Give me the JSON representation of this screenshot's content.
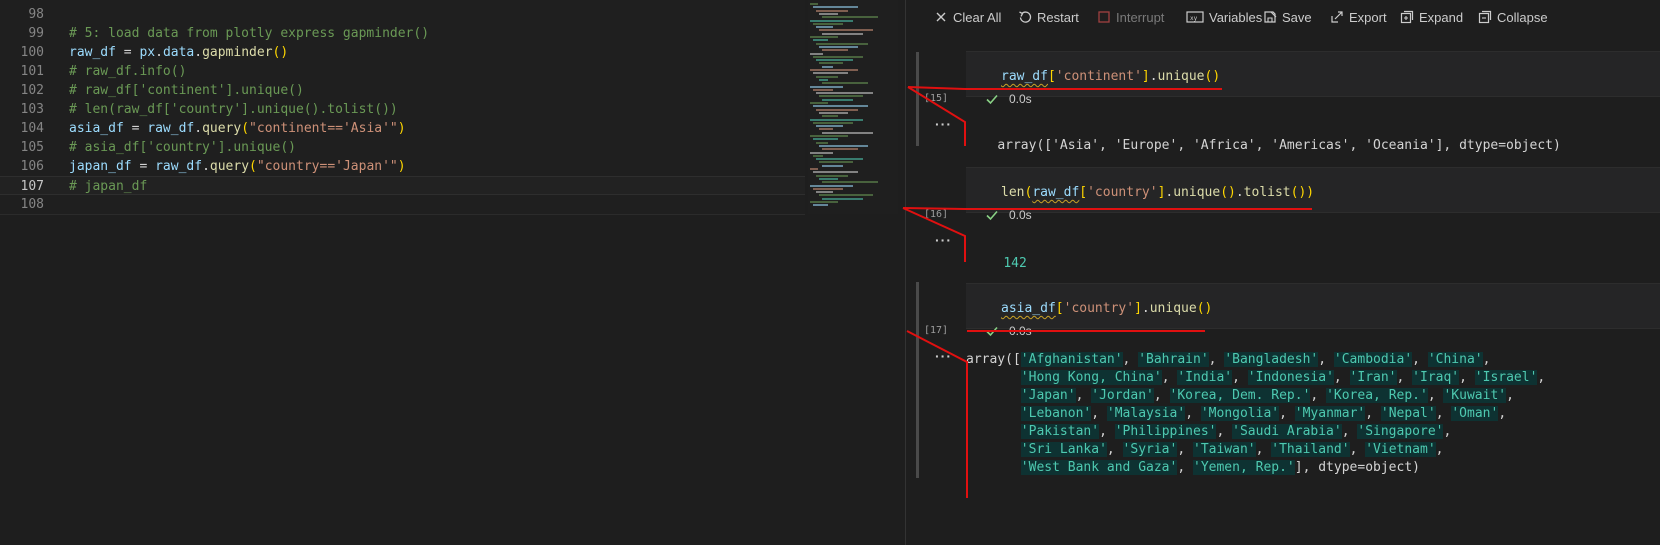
{
  "editor": {
    "lines": [
      {
        "num": "98",
        "tokens": []
      },
      {
        "num": "99",
        "tokens": [
          {
            "c": "cm",
            "t": "# 5: load data from plotly express gapminder()"
          }
        ]
      },
      {
        "num": "100",
        "tokens": [
          {
            "c": "id",
            "t": "raw_df"
          },
          {
            "c": "op",
            "t": " = "
          },
          {
            "c": "id",
            "t": "px"
          },
          {
            "c": "op",
            "t": "."
          },
          {
            "c": "id",
            "t": "data"
          },
          {
            "c": "op",
            "t": "."
          },
          {
            "c": "fn",
            "t": "gapminder"
          },
          {
            "c": "yb",
            "t": "()"
          }
        ]
      },
      {
        "num": "101",
        "tokens": [
          {
            "c": "cm",
            "t": "# raw_df.info()"
          }
        ]
      },
      {
        "num": "102",
        "tokens": [
          {
            "c": "cm",
            "t": "# raw_df['continent'].unique()"
          }
        ]
      },
      {
        "num": "103",
        "tokens": [
          {
            "c": "cm",
            "t": "# len(raw_df['country'].unique().tolist())"
          }
        ]
      },
      {
        "num": "104",
        "tokens": [
          {
            "c": "id",
            "t": "asia_df"
          },
          {
            "c": "op",
            "t": " = "
          },
          {
            "c": "id",
            "t": "raw_df"
          },
          {
            "c": "op",
            "t": "."
          },
          {
            "c": "fn",
            "t": "query"
          },
          {
            "c": "yb",
            "t": "("
          },
          {
            "c": "st",
            "t": "\"continent=='Asia'\""
          },
          {
            "c": "yb",
            "t": ")"
          }
        ]
      },
      {
        "num": "105",
        "tokens": [
          {
            "c": "cm",
            "t": "# asia_df['country'].unique()"
          }
        ]
      },
      {
        "num": "106",
        "tokens": [
          {
            "c": "id",
            "t": "japan_df"
          },
          {
            "c": "op",
            "t": " = "
          },
          {
            "c": "id",
            "t": "raw_df"
          },
          {
            "c": "op",
            "t": "."
          },
          {
            "c": "fn",
            "t": "query"
          },
          {
            "c": "yb",
            "t": "("
          },
          {
            "c": "st",
            "t": "\"country=='Japan'\""
          },
          {
            "c": "yb",
            "t": ")"
          }
        ]
      },
      {
        "num": "107",
        "tokens": [
          {
            "c": "cm",
            "t": "# japan_df"
          }
        ],
        "current": true
      },
      {
        "num": "108",
        "tokens": []
      }
    ]
  },
  "toolbar": {
    "clear_all": "Clear All",
    "restart": "Restart",
    "interrupt": "Interrupt",
    "variables": "Variables",
    "save": "Save",
    "export": "Export",
    "expand": "Expand",
    "collapse": "Collapse"
  },
  "cells": [
    {
      "count": "[15]",
      "code": [
        {
          "c": "id sq",
          "t": "raw_df"
        },
        {
          "c": "yb",
          "t": "["
        },
        {
          "c": "st",
          "t": "'continent'"
        },
        {
          "c": "yb",
          "t": "]"
        },
        {
          "c": "op",
          "t": "."
        },
        {
          "c": "fn",
          "t": "unique"
        },
        {
          "c": "yb",
          "t": "()"
        }
      ],
      "time": "0.0s",
      "output": "array(['Asia', 'Europe', 'Africa', 'Americas', 'Oceania'], dtype=object)"
    },
    {
      "count": "[16]",
      "code": [
        {
          "c": "fn",
          "t": "len"
        },
        {
          "c": "yb",
          "t": "("
        },
        {
          "c": "id sq",
          "t": "raw_df"
        },
        {
          "c": "yb",
          "t": "["
        },
        {
          "c": "st",
          "t": "'country'"
        },
        {
          "c": "yb",
          "t": "]"
        },
        {
          "c": "op",
          "t": "."
        },
        {
          "c": "fn",
          "t": "unique"
        },
        {
          "c": "yb",
          "t": "()"
        },
        {
          "c": "op",
          "t": "."
        },
        {
          "c": "fn",
          "t": "tolist"
        },
        {
          "c": "yb",
          "t": "())"
        }
      ],
      "time": "0.0s",
      "output": "142"
    },
    {
      "count": "[17]",
      "code": [
        {
          "c": "id sq",
          "t": "asia_df"
        },
        {
          "c": "yb",
          "t": "["
        },
        {
          "c": "st",
          "t": "'country'"
        },
        {
          "c": "yb",
          "t": "]"
        },
        {
          "c": "op",
          "t": "."
        },
        {
          "c": "fn",
          "t": "unique"
        },
        {
          "c": "yb",
          "t": "()"
        }
      ],
      "time": "0.0s",
      "output_lines": [
        "array(['Afghanistan', 'Bahrain', 'Bangladesh', 'Cambodia', 'China',",
        "       'Hong Kong, China', 'India', 'Indonesia', 'Iran', 'Iraq', 'Israel',",
        "       'Japan', 'Jordan', 'Korea, Dem. Rep.', 'Korea, Rep.', 'Kuwait',",
        "       'Lebanon', 'Malaysia', 'Mongolia', 'Myanmar', 'Nepal', 'Oman',",
        "       'Pakistan', 'Philippines', 'Saudi Arabia', 'Singapore',",
        "       'Sri Lanka', 'Syria', 'Taiwan', 'Thailand', 'Vietnam',",
        "       'West Bank and Gaza', 'Yemen, Rep.'], dtype=object)"
      ]
    }
  ],
  "more_label": "···",
  "colors": {
    "annotation": "#e01010",
    "output_bg": "#0e3232",
    "check": "#89d185"
  },
  "icons": [
    "close-icon",
    "restart-icon",
    "interrupt-icon",
    "variables-icon",
    "save-icon",
    "export-icon",
    "expand-icon",
    "collapse-icon",
    "check-icon"
  ]
}
